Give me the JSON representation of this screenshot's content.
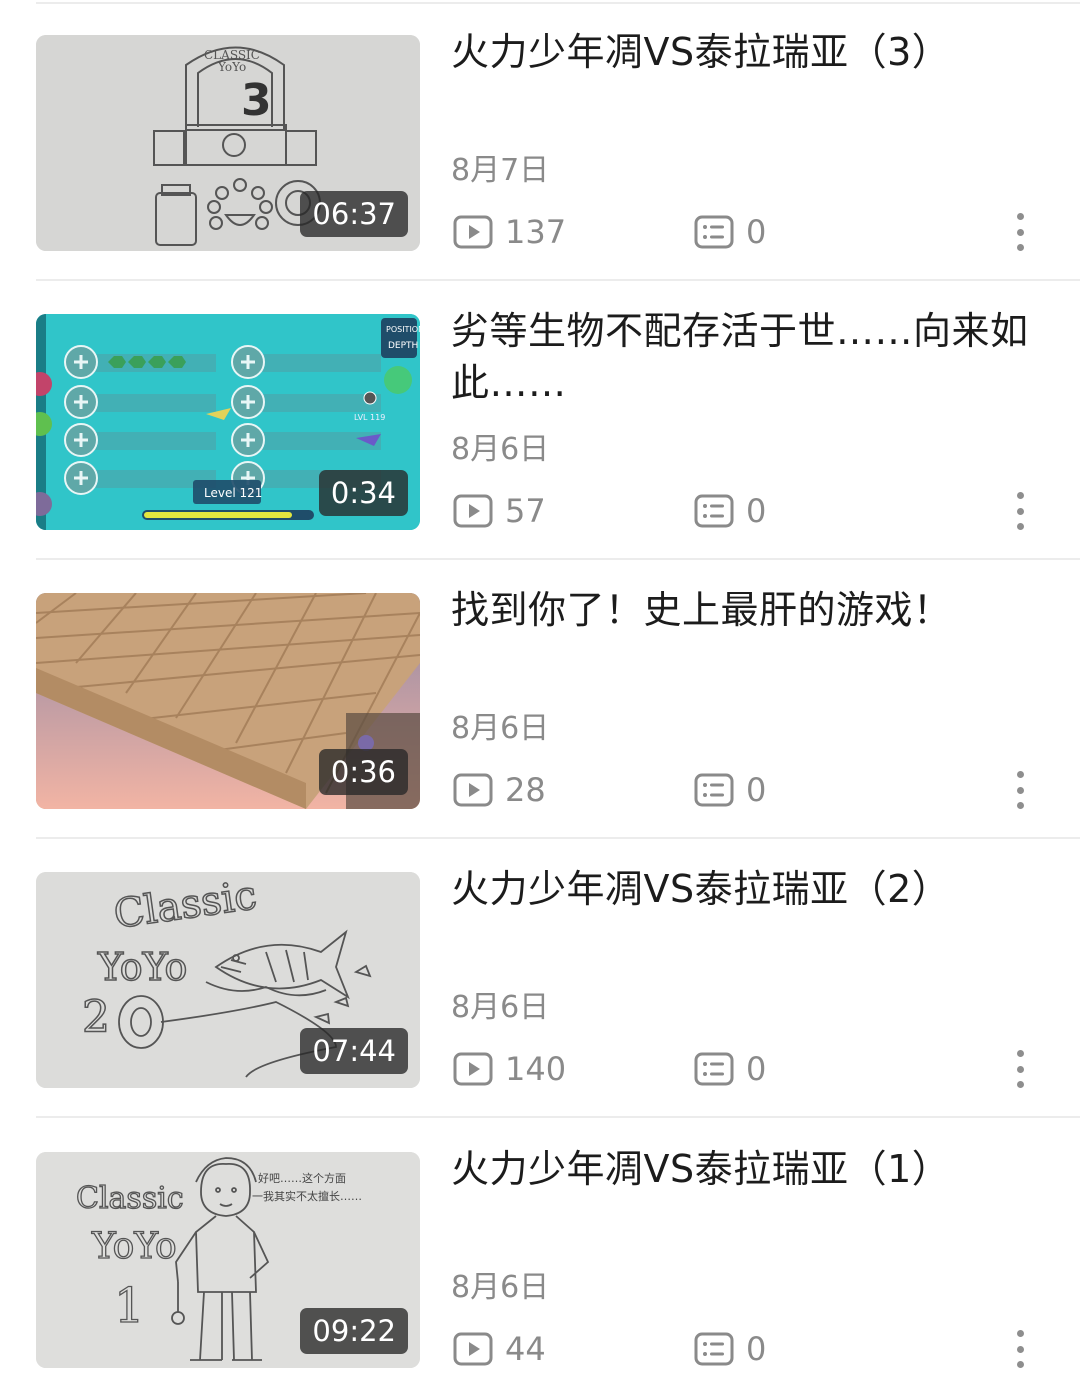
{
  "videos": [
    {
      "title": "火力少年凋VS泰拉瑞亚（3）",
      "date": "8月7日",
      "views": "137",
      "comments": "0",
      "duration": "06:37",
      "thumb": "sketch-chest"
    },
    {
      "title": "劣等生物不配存活于世……向来如此……",
      "date": "8月6日",
      "views": "57",
      "comments": "0",
      "duration": "0:34",
      "thumb": "game-upgrades",
      "thumb_text": {
        "level": "Level 121",
        "position": "POSITION",
        "depth": "DEPTH",
        "lvl": "LVL 119"
      }
    },
    {
      "title": "找到你了！史上最肝的游戏！",
      "date": "8月6日",
      "views": "28",
      "comments": "0",
      "duration": "0:36",
      "thumb": "game-blocks"
    },
    {
      "title": "火力少年凋VS泰拉瑞亚（2）",
      "date": "8月6日",
      "views": "140",
      "comments": "0",
      "duration": "07:44",
      "thumb": "sketch-fish",
      "thumb_text": {
        "line1": "Classic",
        "line2": "YoYo",
        "line3": "2"
      }
    },
    {
      "title": "火力少年凋VS泰拉瑞亚（1）",
      "date": "8月6日",
      "views": "44",
      "comments": "0",
      "duration": "09:22",
      "thumb": "sketch-person",
      "thumb_text": {
        "line1": "Classic",
        "line2": "YoYo",
        "line3": "1",
        "note1": "好吧……这个方面",
        "note2": "一我其实不太擅长……"
      }
    }
  ],
  "icons": {
    "views": "play-count-icon",
    "comments": "comment-count-icon",
    "more": "more-vertical-icon"
  },
  "colors": {
    "text_primary": "#1c1c1c",
    "text_secondary": "#8a8a8a",
    "separator": "#ececec",
    "game_teal": "#2fc4c8"
  }
}
